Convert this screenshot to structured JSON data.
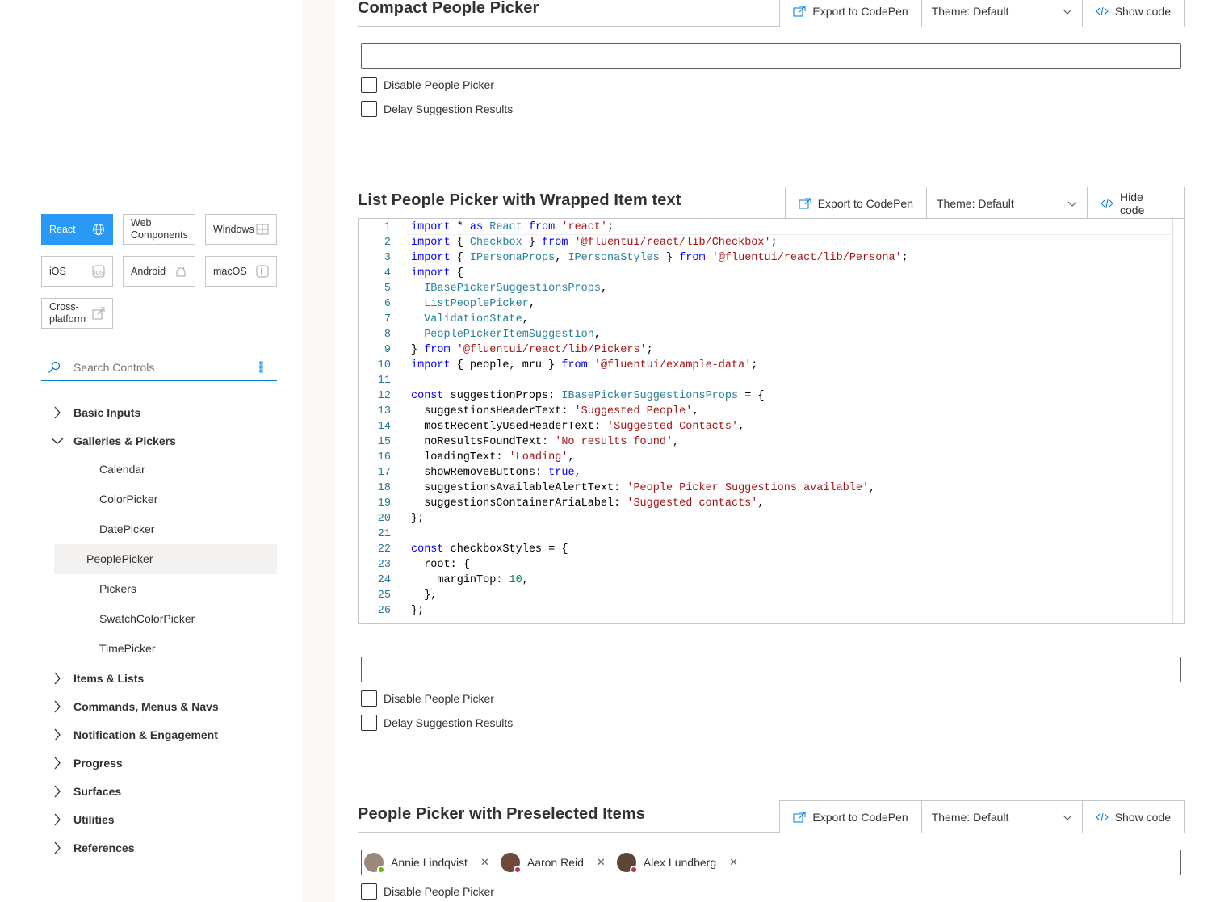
{
  "nav": {
    "platforms": [
      {
        "label": "React",
        "icon": "globe-icon"
      },
      {
        "label": "Web Components",
        "icon": "web-components-icon"
      },
      {
        "label": "Windows",
        "icon": "windows-icon"
      },
      {
        "label": "iOS",
        "icon": "ios-icon"
      },
      {
        "label": "Android",
        "icon": "android-icon"
      },
      {
        "label": "macOS",
        "icon": "macos-icon"
      },
      {
        "label": "Cross-platform",
        "icon": "cross-platform-icon"
      }
    ],
    "active_platform": "React",
    "search_placeholder": "Search Controls",
    "categories": [
      {
        "label": "Basic Inputs",
        "expanded": false
      },
      {
        "label": "Galleries & Pickers",
        "expanded": true
      },
      {
        "label": "Items & Lists",
        "expanded": false
      },
      {
        "label": "Commands, Menus & Navs",
        "expanded": false
      },
      {
        "label": "Notification & Engagement",
        "expanded": false
      },
      {
        "label": "Progress",
        "expanded": false
      },
      {
        "label": "Surfaces",
        "expanded": false
      },
      {
        "label": "Utilities",
        "expanded": false
      },
      {
        "label": "References",
        "expanded": false
      }
    ],
    "galleries_items": [
      "Calendar",
      "ColorPicker",
      "DatePicker",
      "PeoplePicker",
      "Pickers",
      "SwatchColorPicker",
      "TimePicker"
    ],
    "selected_item": "PeoplePicker"
  },
  "toolbar": {
    "export_label": "Export to CodePen",
    "theme_label": "Theme: Default",
    "show_code_label": "Show code",
    "hide_code_label": "Hide code"
  },
  "sections": [
    {
      "title": "Compact People Picker",
      "code_visible": false
    },
    {
      "title": "List People Picker with Wrapped Item text",
      "code_visible": true
    },
    {
      "title": "People Picker with Preselected Items",
      "code_visible": false
    }
  ],
  "checkboxes": {
    "disable": "Disable People Picker",
    "delay": "Delay Suggestion Results"
  },
  "code_lines": [
    "1",
    "2",
    "3",
    "4",
    "5",
    "6",
    "7",
    "8",
    "9",
    "10",
    "11",
    "12",
    "13",
    "14",
    "15",
    "16",
    "17",
    "18",
    "19",
    "20",
    "21",
    "22",
    "23",
    "24",
    "25",
    "26"
  ],
  "preselected": [
    {
      "name": "Annie Lindqvist",
      "presence_color": "#6bb700"
    },
    {
      "name": "Aaron Reid",
      "presence_color": "#c4314b"
    },
    {
      "name": "Alex Lundberg",
      "presence_color": "#c4314b"
    }
  ],
  "colors": {
    "accent": "#0078d4",
    "active_platform": "#2899f5",
    "keyword": "#0000ff",
    "type": "#267f99",
    "string": "#a31515",
    "number": "#098658",
    "line_number": "#237893"
  }
}
